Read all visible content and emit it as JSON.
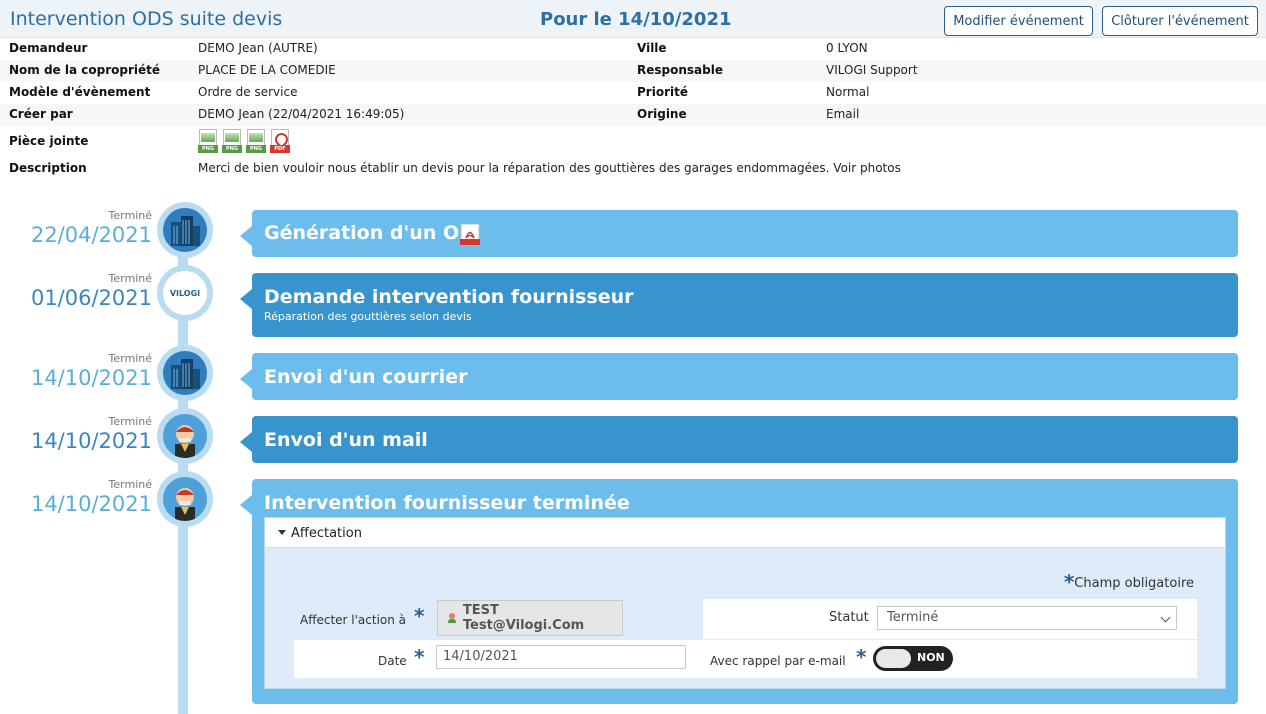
{
  "header": {
    "title": "Intervention ODS suite devis",
    "center_date": "Pour le 14/10/2021",
    "modify_button": "Modifier événement",
    "close_button": "Clôturer l'événement"
  },
  "info": {
    "demandeur_label": "Demandeur",
    "demandeur_value": "DEMO Jean (AUTRE)",
    "ville_label": "Ville",
    "ville_value": "0 LYON",
    "copro_label": "Nom de la copropriété",
    "copro_value": "PLACE DE LA COMEDIE",
    "responsable_label": "Responsable",
    "responsable_value": "VILOGI Support",
    "modele_label": "Modèle d'évènement",
    "modele_value": "Ordre de service",
    "priorite_label": "Priorité",
    "priorite_value": "Normal",
    "creer_label": "Créer par",
    "creer_value": "DEMO Jean (22/04/2021 16:49:05)",
    "origine_label": "Origine",
    "origine_value": "Email",
    "piece_label": "Pièce jointe",
    "attachments": [
      "PNG",
      "PNG",
      "PNG",
      "PDF"
    ],
    "description_label": "Description",
    "description_value": "Merci de bien vouloir nous établir un devis pour la réparation des gouttières des garages endommagées. Voir photos"
  },
  "timeline": [
    {
      "status": "Terminé",
      "date": "22/04/2021",
      "title": "Génération d'un OS",
      "subtitle": "",
      "avatar": "building-icon"
    },
    {
      "status": "Terminé",
      "date": "01/06/2021",
      "title": "Demande intervention fournisseur",
      "subtitle": "Réparation des gouttières selon devis",
      "avatar": "vilogi-logo",
      "logo_text": "VILOGI"
    },
    {
      "status": "Terminé",
      "date": "14/10/2021",
      "title": "Envoi d'un courrier",
      "subtitle": "",
      "avatar": "building-icon"
    },
    {
      "status": "Terminé",
      "date": "14/10/2021",
      "title": "Envoi d'un mail",
      "subtitle": "",
      "avatar": "person-icon"
    },
    {
      "status": "Terminé",
      "date": "14/10/2021",
      "title": "Intervention fournisseur terminée",
      "subtitle": "",
      "avatar": "person-icon"
    }
  ],
  "affectation": {
    "panel_title": "Affectation",
    "required_note": "Champ obligatoire",
    "assign_label": "Affecter l'action à",
    "assign_value": "TEST Test@Vilogi.Com",
    "status_label": "Statut",
    "status_value": "Terminé",
    "date_label": "Date",
    "date_value": "14/10/2021",
    "reminder_label": "Avec rappel par e-mail",
    "reminder_value": "NON"
  },
  "colors": {
    "accent": "#2b6fa5",
    "bubble_light": "#6dbdec",
    "bubble_dark": "#3894cd",
    "timeline": "#b9dcf1"
  }
}
